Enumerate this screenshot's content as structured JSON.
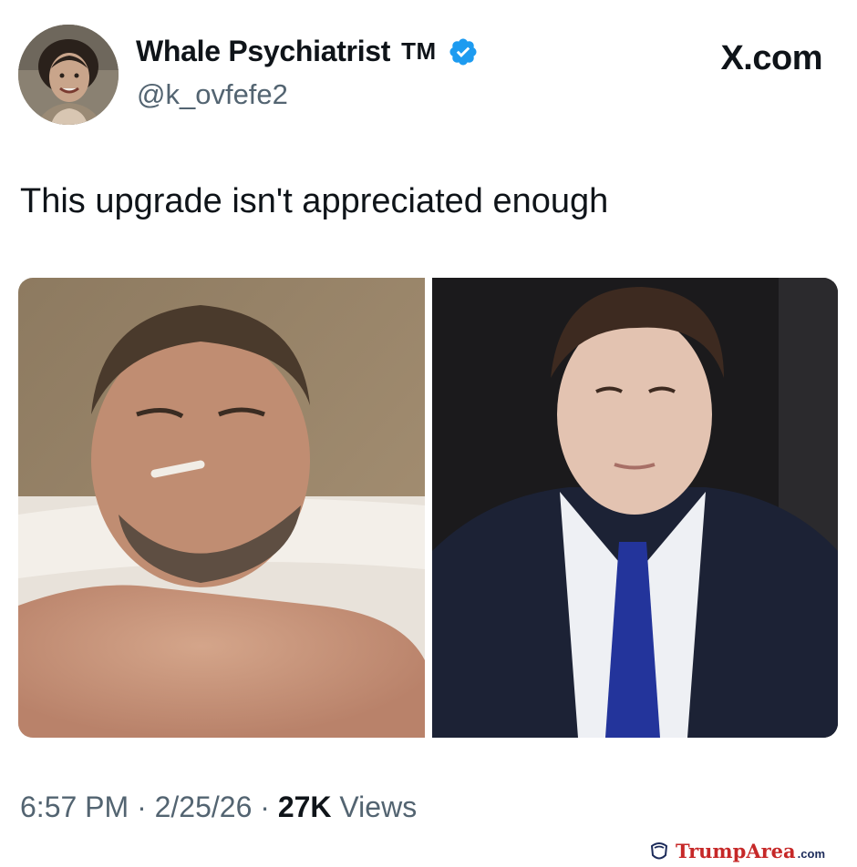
{
  "tweet": {
    "display_name": "Whale Psychiatrist",
    "tm": "TM",
    "handle": "@k_ovfefe2",
    "platform": "X.com",
    "text": "This upgrade isn't appreciated enough",
    "time": "6:57 PM",
    "date": "2/25/26",
    "views_count": "27K",
    "views_label": "Views",
    "separator": " · "
  },
  "icons": {
    "verified": "verified-badge-icon",
    "watermark": "trumparea-logo-icon"
  },
  "colors": {
    "verified": "#1d9bf0",
    "secondary_text": "#536471",
    "watermark": "#c62828"
  },
  "watermark": {
    "name": "TrumpArea",
    "suffix": ".com"
  }
}
